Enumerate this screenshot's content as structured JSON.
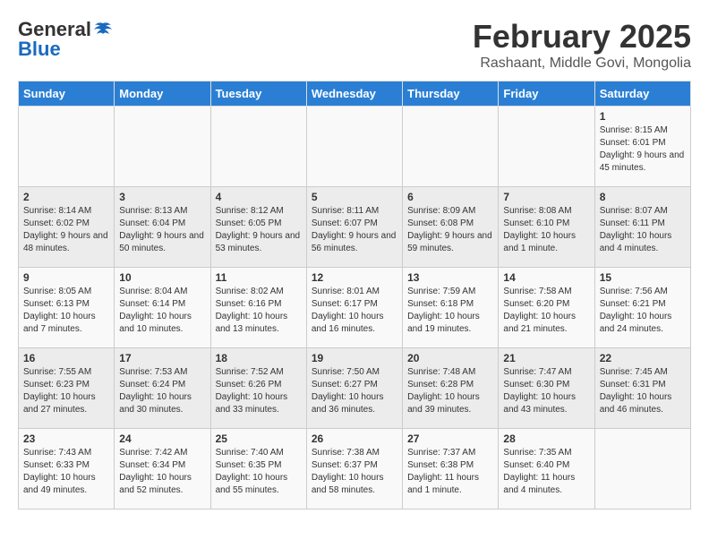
{
  "header": {
    "logo_general": "General",
    "logo_blue": "Blue",
    "month_title": "February 2025",
    "location": "Rashaant, Middle Govi, Mongolia"
  },
  "days_of_week": [
    "Sunday",
    "Monday",
    "Tuesday",
    "Wednesday",
    "Thursday",
    "Friday",
    "Saturday"
  ],
  "weeks": [
    {
      "cells": [
        {
          "day": "",
          "info": ""
        },
        {
          "day": "",
          "info": ""
        },
        {
          "day": "",
          "info": ""
        },
        {
          "day": "",
          "info": ""
        },
        {
          "day": "",
          "info": ""
        },
        {
          "day": "",
          "info": ""
        },
        {
          "day": "1",
          "info": "Sunrise: 8:15 AM\nSunset: 6:01 PM\nDaylight: 9 hours and 45 minutes."
        }
      ]
    },
    {
      "cells": [
        {
          "day": "2",
          "info": "Sunrise: 8:14 AM\nSunset: 6:02 PM\nDaylight: 9 hours and 48 minutes."
        },
        {
          "day": "3",
          "info": "Sunrise: 8:13 AM\nSunset: 6:04 PM\nDaylight: 9 hours and 50 minutes."
        },
        {
          "day": "4",
          "info": "Sunrise: 8:12 AM\nSunset: 6:05 PM\nDaylight: 9 hours and 53 minutes."
        },
        {
          "day": "5",
          "info": "Sunrise: 8:11 AM\nSunset: 6:07 PM\nDaylight: 9 hours and 56 minutes."
        },
        {
          "day": "6",
          "info": "Sunrise: 8:09 AM\nSunset: 6:08 PM\nDaylight: 9 hours and 59 minutes."
        },
        {
          "day": "7",
          "info": "Sunrise: 8:08 AM\nSunset: 6:10 PM\nDaylight: 10 hours and 1 minute."
        },
        {
          "day": "8",
          "info": "Sunrise: 8:07 AM\nSunset: 6:11 PM\nDaylight: 10 hours and 4 minutes."
        }
      ]
    },
    {
      "cells": [
        {
          "day": "9",
          "info": "Sunrise: 8:05 AM\nSunset: 6:13 PM\nDaylight: 10 hours and 7 minutes."
        },
        {
          "day": "10",
          "info": "Sunrise: 8:04 AM\nSunset: 6:14 PM\nDaylight: 10 hours and 10 minutes."
        },
        {
          "day": "11",
          "info": "Sunrise: 8:02 AM\nSunset: 6:16 PM\nDaylight: 10 hours and 13 minutes."
        },
        {
          "day": "12",
          "info": "Sunrise: 8:01 AM\nSunset: 6:17 PM\nDaylight: 10 hours and 16 minutes."
        },
        {
          "day": "13",
          "info": "Sunrise: 7:59 AM\nSunset: 6:18 PM\nDaylight: 10 hours and 19 minutes."
        },
        {
          "day": "14",
          "info": "Sunrise: 7:58 AM\nSunset: 6:20 PM\nDaylight: 10 hours and 21 minutes."
        },
        {
          "day": "15",
          "info": "Sunrise: 7:56 AM\nSunset: 6:21 PM\nDaylight: 10 hours and 24 minutes."
        }
      ]
    },
    {
      "cells": [
        {
          "day": "16",
          "info": "Sunrise: 7:55 AM\nSunset: 6:23 PM\nDaylight: 10 hours and 27 minutes."
        },
        {
          "day": "17",
          "info": "Sunrise: 7:53 AM\nSunset: 6:24 PM\nDaylight: 10 hours and 30 minutes."
        },
        {
          "day": "18",
          "info": "Sunrise: 7:52 AM\nSunset: 6:26 PM\nDaylight: 10 hours and 33 minutes."
        },
        {
          "day": "19",
          "info": "Sunrise: 7:50 AM\nSunset: 6:27 PM\nDaylight: 10 hours and 36 minutes."
        },
        {
          "day": "20",
          "info": "Sunrise: 7:48 AM\nSunset: 6:28 PM\nDaylight: 10 hours and 39 minutes."
        },
        {
          "day": "21",
          "info": "Sunrise: 7:47 AM\nSunset: 6:30 PM\nDaylight: 10 hours and 43 minutes."
        },
        {
          "day": "22",
          "info": "Sunrise: 7:45 AM\nSunset: 6:31 PM\nDaylight: 10 hours and 46 minutes."
        }
      ]
    },
    {
      "cells": [
        {
          "day": "23",
          "info": "Sunrise: 7:43 AM\nSunset: 6:33 PM\nDaylight: 10 hours and 49 minutes."
        },
        {
          "day": "24",
          "info": "Sunrise: 7:42 AM\nSunset: 6:34 PM\nDaylight: 10 hours and 52 minutes."
        },
        {
          "day": "25",
          "info": "Sunrise: 7:40 AM\nSunset: 6:35 PM\nDaylight: 10 hours and 55 minutes."
        },
        {
          "day": "26",
          "info": "Sunrise: 7:38 AM\nSunset: 6:37 PM\nDaylight: 10 hours and 58 minutes."
        },
        {
          "day": "27",
          "info": "Sunrise: 7:37 AM\nSunset: 6:38 PM\nDaylight: 11 hours and 1 minute."
        },
        {
          "day": "28",
          "info": "Sunrise: 7:35 AM\nSunset: 6:40 PM\nDaylight: 11 hours and 4 minutes."
        },
        {
          "day": "",
          "info": ""
        }
      ]
    }
  ]
}
